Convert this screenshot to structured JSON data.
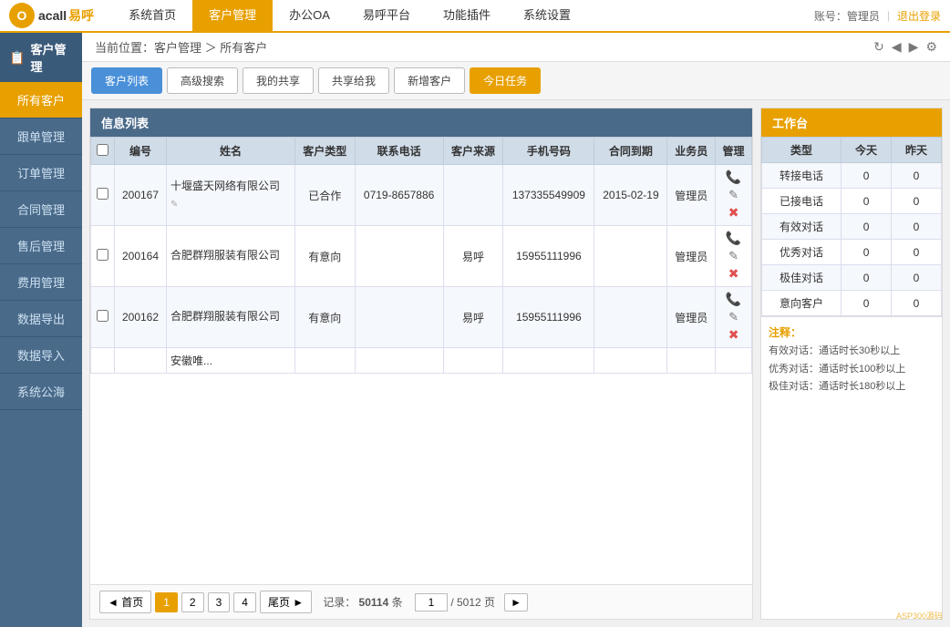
{
  "app": {
    "logo_o": "O",
    "logo_name": "acall",
    "logo_sub": "易呼"
  },
  "top_nav": {
    "items": [
      {
        "label": "系统首页",
        "active": false
      },
      {
        "label": "客户管理",
        "active": true
      },
      {
        "label": "办公OA",
        "active": false
      },
      {
        "label": "易呼平台",
        "active": false
      },
      {
        "label": "功能插件",
        "active": false
      },
      {
        "label": "系统设置",
        "active": false
      }
    ],
    "account_label": "账号：管理员",
    "logout_label": "退出登录"
  },
  "sidebar": {
    "title": "客户管理",
    "items": [
      {
        "label": "所有客户",
        "active": true
      },
      {
        "label": "跟单管理",
        "active": false
      },
      {
        "label": "订单管理",
        "active": false
      },
      {
        "label": "合同管理",
        "active": false
      },
      {
        "label": "售后管理",
        "active": false
      },
      {
        "label": "费用管理",
        "active": false
      },
      {
        "label": "数据导出",
        "active": false
      },
      {
        "label": "数据导入",
        "active": false
      },
      {
        "label": "系统公海",
        "active": false
      }
    ]
  },
  "breadcrumb": {
    "text": "当前位置：客户管理 ＞ 所有客户"
  },
  "tabs": [
    {
      "label": "客户列表",
      "active": true,
      "style": "normal"
    },
    {
      "label": "高级搜索",
      "active": false,
      "style": "normal"
    },
    {
      "label": "我的共享",
      "active": false,
      "style": "normal"
    },
    {
      "label": "共享给我",
      "active": false,
      "style": "normal"
    },
    {
      "label": "新增客户",
      "active": false,
      "style": "normal"
    },
    {
      "label": "今日任务",
      "active": false,
      "style": "orange"
    }
  ],
  "info_table": {
    "panel_title": "信息列表",
    "columns": [
      "编号",
      "姓名",
      "客户类型",
      "联系电话",
      "客户来源",
      "手机号码",
      "合同到期",
      "业务员",
      "管理"
    ],
    "rows": [
      {
        "id": "200167",
        "name": "十堰盛天网络有限公司",
        "type": "已合作",
        "phone": "0719-8657886",
        "source": "",
        "mobile": "137335549909",
        "contract_end": "2015-02-19",
        "staff": "管理员",
        "has_edit": true
      },
      {
        "id": "200164",
        "name": "合肥群翔服装有限公司",
        "type": "有意向",
        "phone": "",
        "source": "易呼",
        "mobile": "15955111996",
        "contract_end": "",
        "staff": "管理员",
        "has_edit": false
      },
      {
        "id": "200162",
        "name": "合肥群翔服装有限公司",
        "type": "有意向",
        "phone": "",
        "source": "易呼",
        "mobile": "15955111996",
        "contract_end": "",
        "staff": "管理员",
        "has_edit": false
      },
      {
        "id": "",
        "name": "安徽唯...",
        "type": "",
        "phone": "",
        "source": "",
        "mobile": "",
        "contract_end": "",
        "staff": "",
        "has_edit": false,
        "partial": true
      }
    ]
  },
  "pagination": {
    "first_label": "◄ 首页",
    "prev_label": "◄",
    "next_label": "►",
    "last_label": "尾页 ►",
    "pages": [
      "1",
      "2",
      "3",
      "4"
    ],
    "active_page": "1",
    "records_label": "记录：",
    "total_records": "50114",
    "records_unit": "条",
    "page_label": "1",
    "total_pages": "5012",
    "page_unit": "页"
  },
  "workbench": {
    "panel_title": "工作台",
    "columns": [
      "类型",
      "今天",
      "昨天"
    ],
    "rows": [
      {
        "type": "转接电话",
        "today": "0",
        "yesterday": "0"
      },
      {
        "type": "已接电话",
        "today": "0",
        "yesterday": "0"
      },
      {
        "type": "有效对话",
        "today": "0",
        "yesterday": "0"
      },
      {
        "type": "优秀对话",
        "today": "0",
        "yesterday": "0"
      },
      {
        "type": "极佳对话",
        "today": "0",
        "yesterday": "0"
      },
      {
        "type": "意向客户",
        "today": "0",
        "yesterday": "0"
      }
    ],
    "notes": {
      "title": "注释：",
      "items": [
        "有效对话：通话时长30秒以上",
        "优秀对话：通话时长100秒以上",
        "极佳对话：通话时长180秒以上"
      ]
    }
  }
}
